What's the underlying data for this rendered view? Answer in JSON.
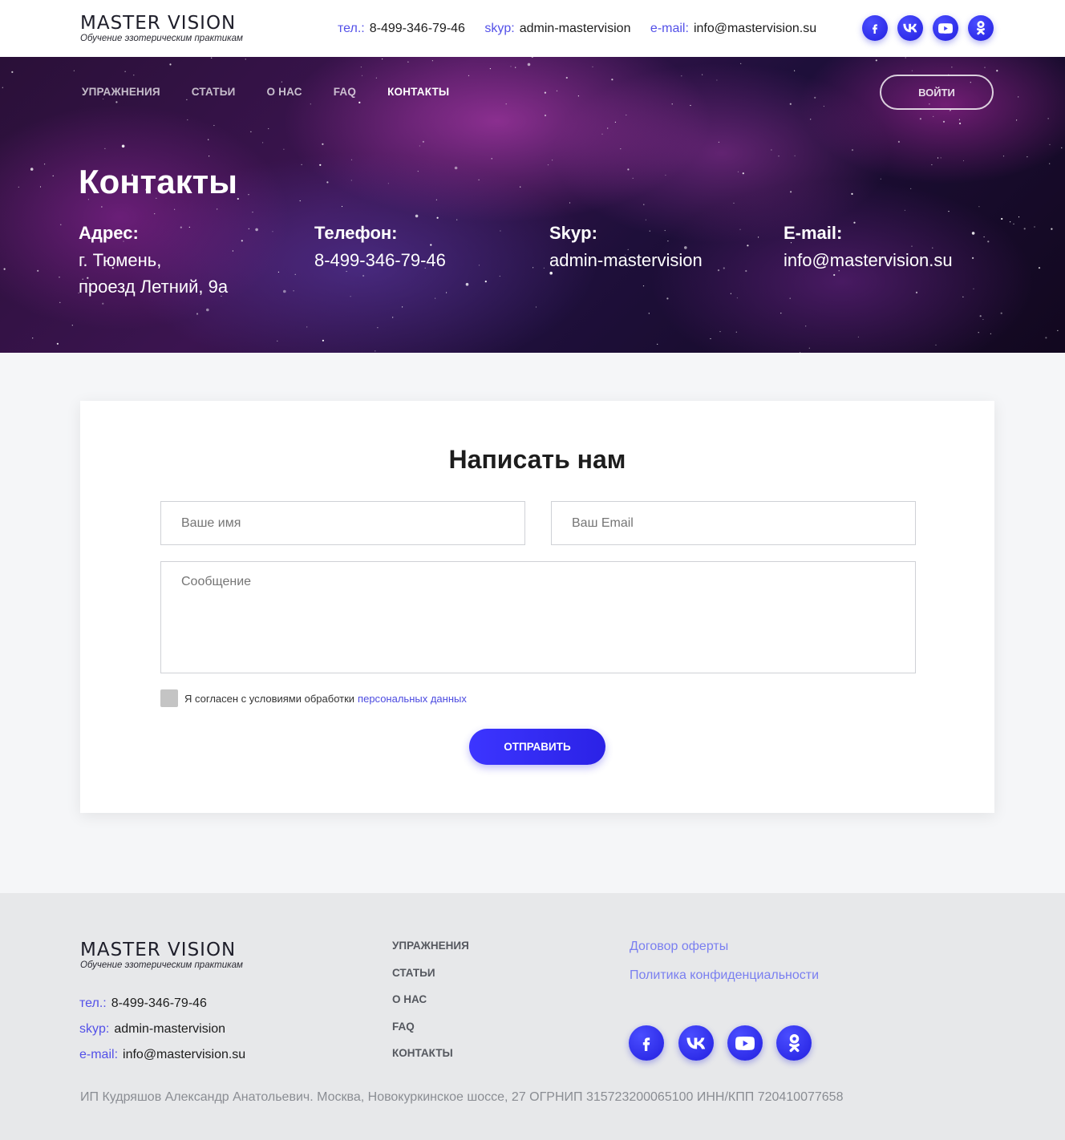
{
  "brand": {
    "name": "MASTER VISION",
    "tagline": "Обучение эзотерическим практикам"
  },
  "header": {
    "phone_label": "тел.:",
    "phone": "8-499-346-79-46",
    "skype_label": "skyp:",
    "skype": "admin-mastervision",
    "email_label": "e-mail:",
    "email": "info@mastervision.su"
  },
  "socials": [
    "facebook-icon",
    "vk-icon",
    "youtube-icon",
    "odnoklassniki-icon"
  ],
  "nav": {
    "items": [
      "УПРАЖНЕНИЯ",
      "СТАТЬИ",
      "О НАС",
      "FAQ",
      "КОНТАКТЫ"
    ],
    "active": "КОНТАКТЫ",
    "login": "ВОЙТИ"
  },
  "hero": {
    "title": "Контакты",
    "address_label": "Адрес:",
    "address_line1": "г. Тюмень,",
    "address_line2": "проезд Летний, 9а",
    "phone_label": "Телефон:",
    "phone": "8-499-346-79-46",
    "skype_label": "Skyp:",
    "skype": "admin-mastervision",
    "email_label": "E-mail:",
    "email": "info@mastervision.su"
  },
  "form": {
    "title": "Написать нам",
    "name_placeholder": "Ваше имя",
    "email_placeholder": "Ваш Email",
    "message_placeholder": "Сообщение",
    "consent_text": "Я согласен с условиями обработки",
    "consent_link": "персональных данных",
    "submit": "ОТПРАВИТЬ"
  },
  "footer": {
    "nav": [
      "УПРАЖНЕНИЯ",
      "СТАТЬИ",
      "О НАС",
      "FAQ",
      "КОНТАКТЫ"
    ],
    "links": [
      "Договор оферты",
      "Политика конфиденциальности"
    ],
    "phone_label": "тел.:",
    "phone": "8-499-346-79-46",
    "skype_label": "skyp:",
    "skype": "admin-mastervision",
    "email_label": "e-mail:",
    "email": "info@mastervision.su",
    "legal": "ИП Кудряшов Александр Анатольевич. Москва, Новокуркинское шоссе, 27 ОГРНИП 315723200065100 ИНН/КПП 720410077658"
  },
  "colors": {
    "accent": "#5350e8",
    "button": "#2b22e6",
    "footer_bg": "#e7e8ea",
    "page_bg": "#f5f6f8"
  }
}
